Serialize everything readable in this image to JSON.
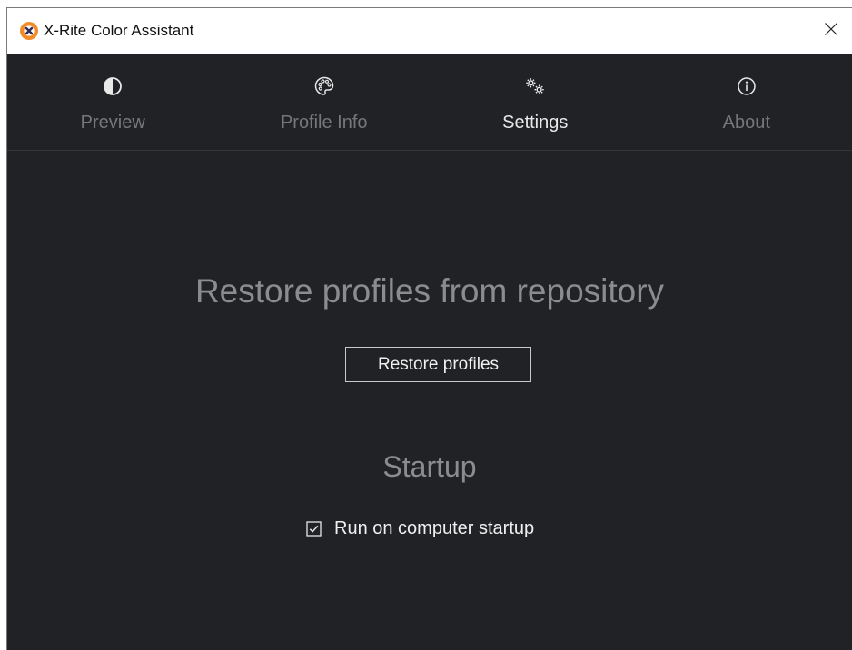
{
  "window": {
    "title": "X-Rite Color Assistant",
    "close_icon": "close-icon",
    "app_icon": "x-rite-logo-icon"
  },
  "colors": {
    "background": "#212225",
    "active_tab_text": "#e8e8e8",
    "inactive_tab_text": "#75777b",
    "section_title": "#8b8c8f",
    "app_icon_orange": "#f28c28"
  },
  "tabs": [
    {
      "label": "Preview",
      "icon": "contrast-icon",
      "active": false
    },
    {
      "label": "Profile Info",
      "icon": "palette-icon",
      "active": false
    },
    {
      "label": "Settings",
      "icon": "gears-icon",
      "active": true
    },
    {
      "label": "About",
      "icon": "info-icon",
      "active": false
    }
  ],
  "settings": {
    "restore_title": "Restore profiles from repository",
    "restore_button_label": "Restore profiles",
    "startup_title": "Startup",
    "run_on_startup_label": "Run on computer startup",
    "run_on_startup_checked": true
  }
}
